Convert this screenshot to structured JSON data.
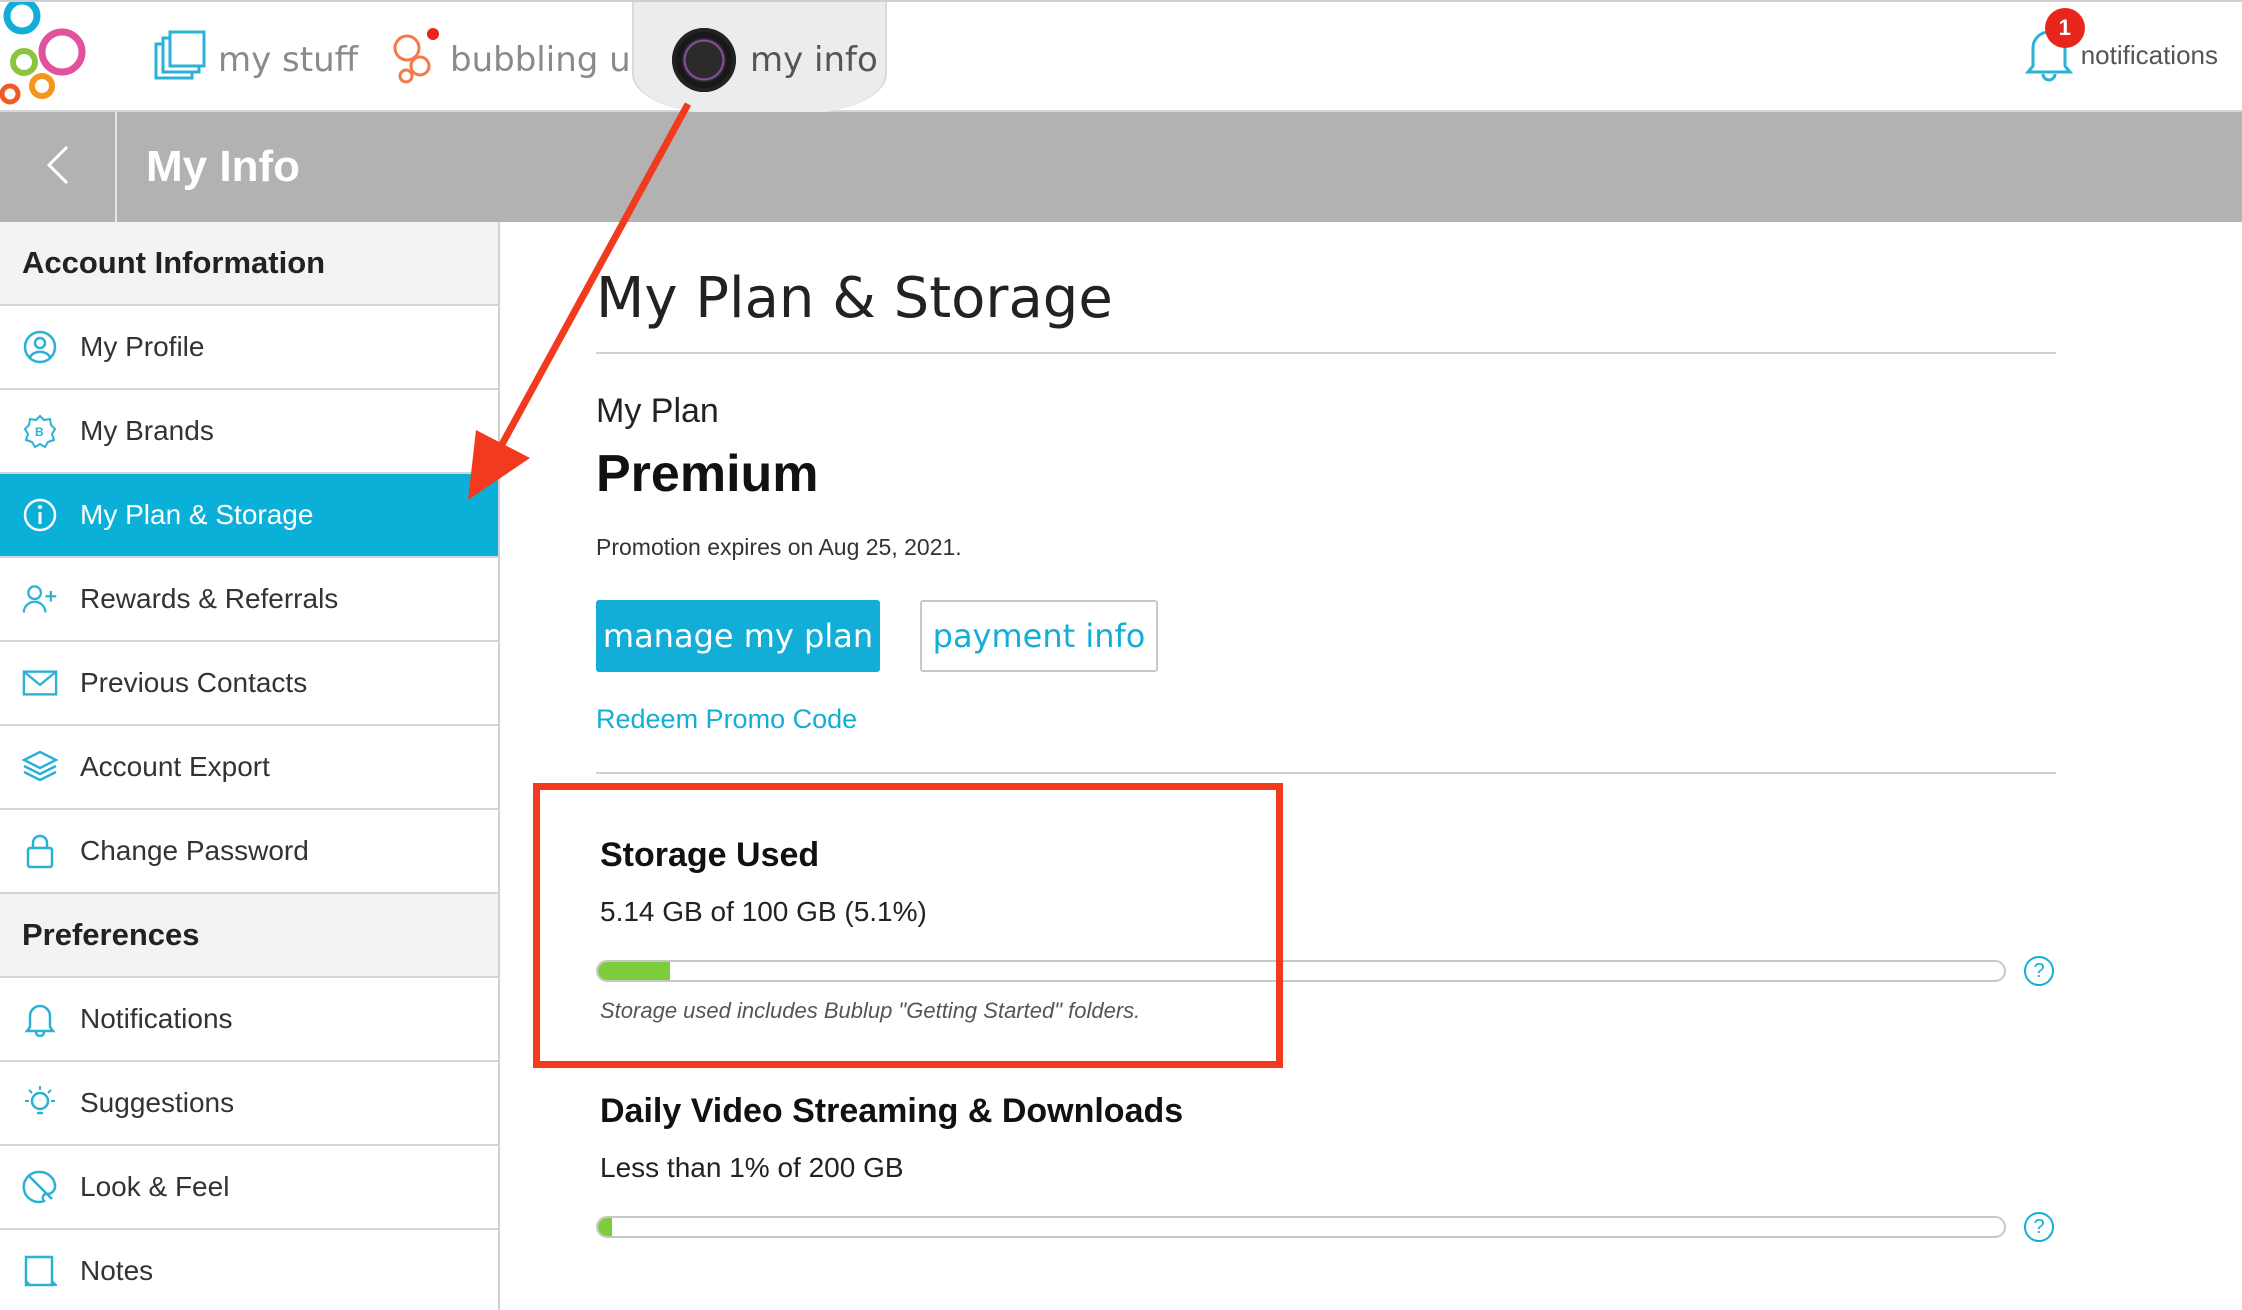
{
  "topnav": {
    "tabs": [
      {
        "label": "my stuff",
        "icon": "folders-icon"
      },
      {
        "label": "bubbling up",
        "icon": "bubbles-icon"
      },
      {
        "label": "my info",
        "icon": "avatar"
      }
    ],
    "notifications": {
      "label": "notifications",
      "count": "1",
      "icon": "bell-icon"
    }
  },
  "titlebar": {
    "title": "My Info",
    "back_icon": "chevron-left-icon"
  },
  "sidebar": {
    "account_header": "Account Information",
    "account_items": [
      {
        "label": "My Profile",
        "icon": "user-circle-icon"
      },
      {
        "label": "My Brands",
        "icon": "brand-badge-icon"
      },
      {
        "label": "My Plan & Storage",
        "icon": "info-icon",
        "active": true
      },
      {
        "label": "Rewards & Referrals",
        "icon": "add-user-icon"
      },
      {
        "label": "Previous Contacts",
        "icon": "envelope-icon"
      },
      {
        "label": "Account Export",
        "icon": "layers-icon"
      },
      {
        "label": "Change Password",
        "icon": "lock-icon"
      }
    ],
    "preferences_header": "Preferences",
    "preference_items": [
      {
        "label": "Notifications",
        "icon": "bell-icon"
      },
      {
        "label": "Suggestions",
        "icon": "lightbulb-icon"
      },
      {
        "label": "Look & Feel",
        "icon": "palette-icon"
      },
      {
        "label": "Notes",
        "icon": "note-icon"
      }
    ]
  },
  "main": {
    "heading": "My Plan & Storage",
    "plan_label": "My Plan",
    "plan_name": "Premium",
    "promo_text": "Promotion expires on Aug 25, 2021.",
    "manage_button": "manage my plan",
    "payment_button": "payment info",
    "redeem_link": "Redeem Promo Code",
    "storage": {
      "title": "Storage Used",
      "value": "5.14 GB of 100 GB (5.1%)",
      "percent": 5.1,
      "note": "Storage used includes Bublup \"Getting Started\" folders."
    },
    "streaming": {
      "title": "Daily Video Streaming & Downloads",
      "value": "Less than 1% of 200 GB",
      "percent": 1
    },
    "help_glyph": "?"
  },
  "colors": {
    "accent": "#12aed7",
    "active_sidebar": "#0bb0d8",
    "bar_fill": "#7ccc3c",
    "annotation": "#f23b1e",
    "badge": "#e8261b",
    "titlebar": "#b2b2b2"
  }
}
